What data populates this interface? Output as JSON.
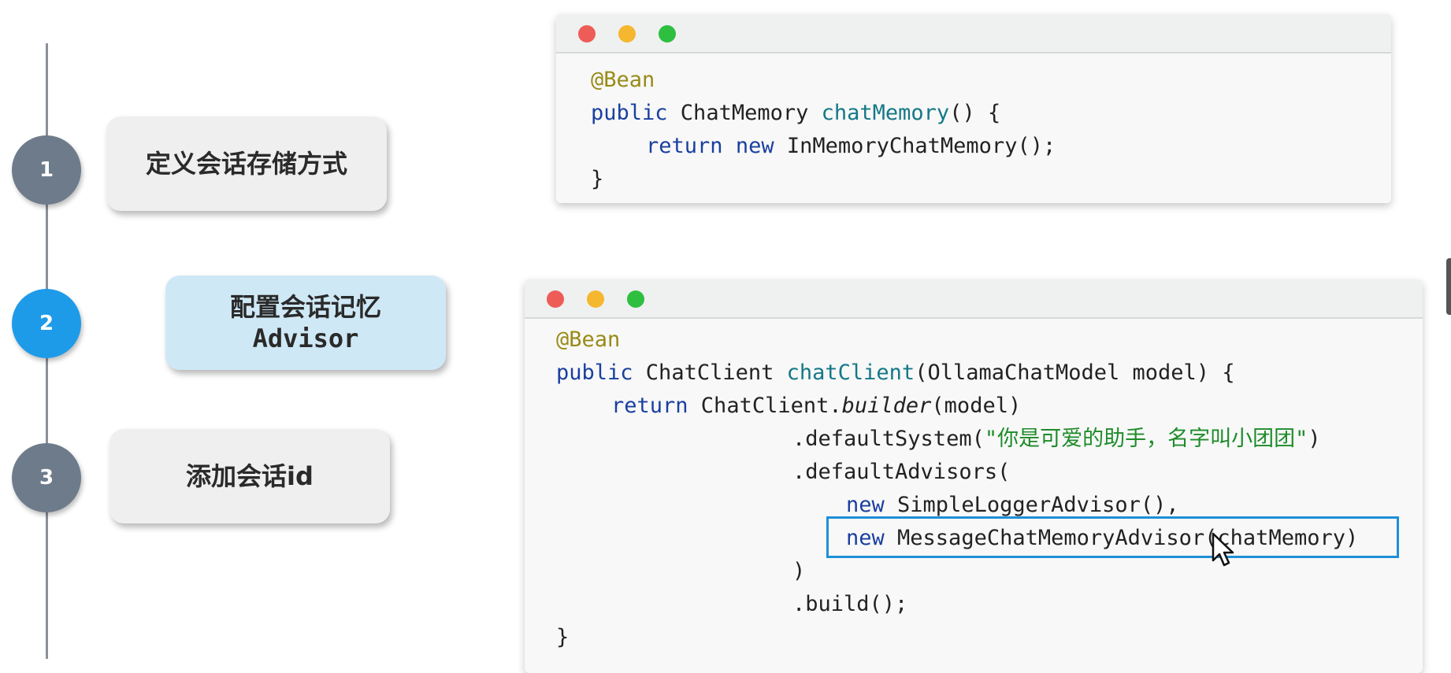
{
  "steps": [
    {
      "number": "1",
      "label": "定义会话存储方式",
      "circle_color": "#6e7b8b",
      "card_color": "#efefef"
    },
    {
      "number": "2",
      "label_line1": "配置会话记忆",
      "label_line2": "Advisor",
      "circle_color": "#1e9be8",
      "card_color": "#cfe8f6"
    },
    {
      "number": "3",
      "label": "添加会话id",
      "circle_color": "#6e7b8b",
      "card_color": "#efefef"
    }
  ],
  "window_controls": {
    "close_color": "#ee5c57",
    "minimize_color": "#f5b72f",
    "maximize_color": "#2ebf40"
  },
  "code1": {
    "l1": "@Bean",
    "l2_kw": "public",
    "l2_type": " ChatMemory ",
    "l2_fn": "chatMemory",
    "l2_rest": "() {",
    "l3_kw1": "return",
    "l3_kw2": "new",
    "l3_rest": " InMemoryChatMemory();",
    "l4": "}"
  },
  "code2": {
    "l1": "@Bean",
    "l2_kw": "public",
    "l2_type": " ChatClient ",
    "l2_fn": "chatClient",
    "l2_rest": "(OllamaChatModel model) {",
    "l3_kw": "return",
    "l3_a": " ChatClient.",
    "l3_it": "builder",
    "l3_b": "(model)",
    "l4_a": ".defaultSystem(",
    "l4_str": "\"你是可爱的助手，名字叫小团团\"",
    "l4_b": ")",
    "l5": ".defaultAdvisors(",
    "l6_kw": "new",
    "l6_rest": " SimpleLoggerAdvisor(),",
    "l7_kw": "new",
    "l7_rest": " MessageChatMemoryAdvisor(chatMemory)",
    "l8": ")",
    "l9": ".build();",
    "l10": "}"
  }
}
